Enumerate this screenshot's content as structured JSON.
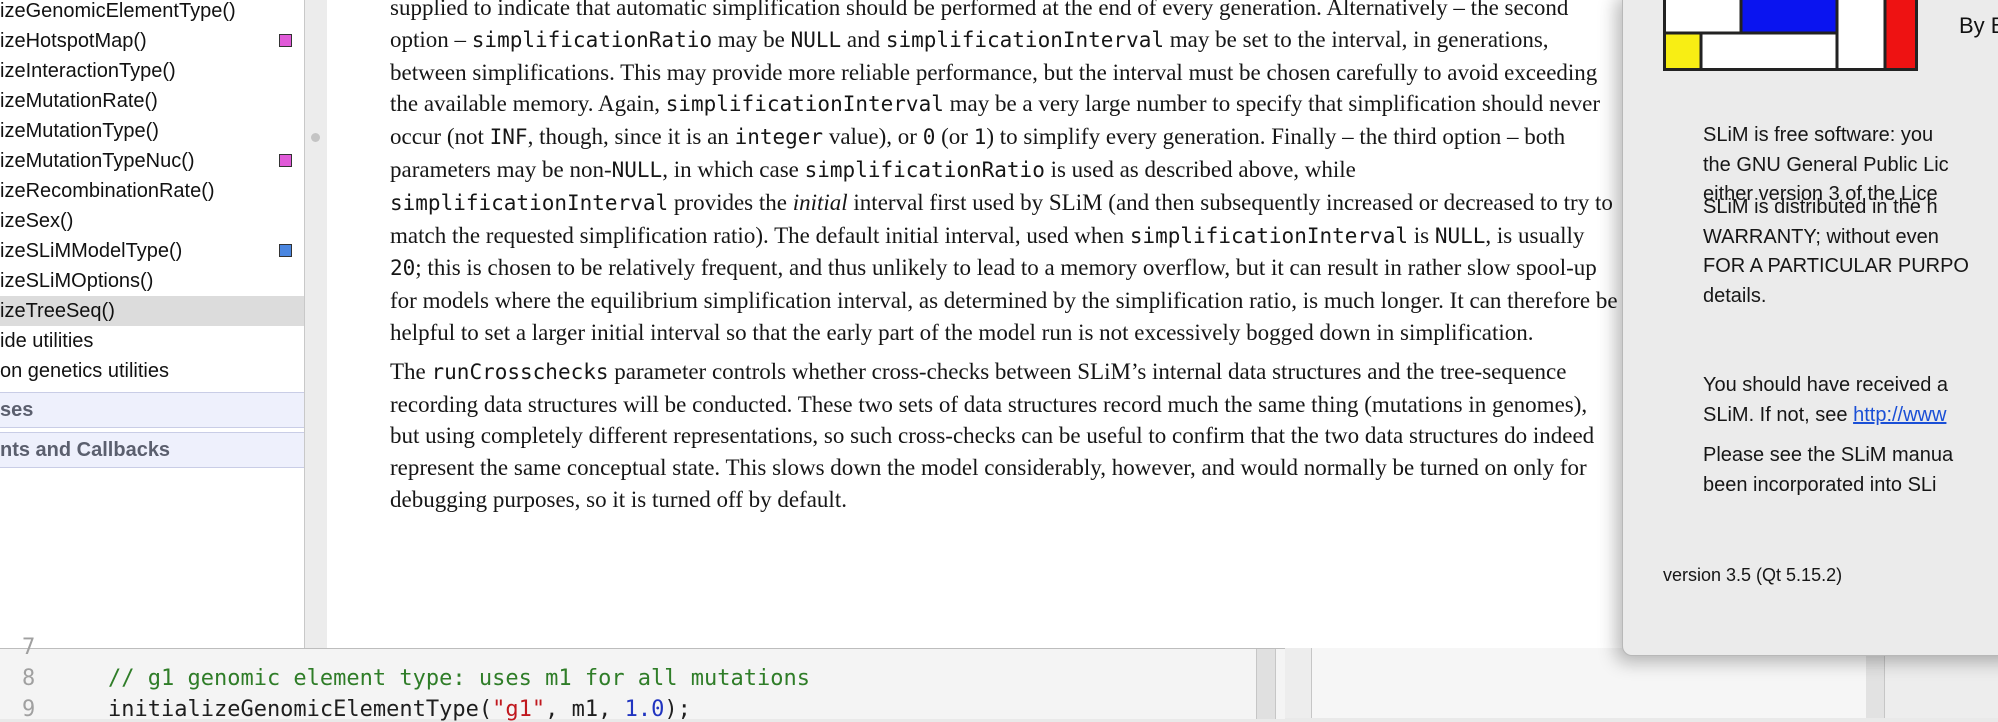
{
  "sidebar": {
    "items": [
      {
        "label": "izeGenomicElementType()",
        "swatch": ""
      },
      {
        "label": "izeHotspotMap()",
        "swatch": "#e05ad8"
      },
      {
        "label": "izeInteractionType()",
        "swatch": ""
      },
      {
        "label": "izeMutationRate()",
        "swatch": ""
      },
      {
        "label": "izeMutationType()",
        "swatch": ""
      },
      {
        "label": "izeMutationTypeNuc()",
        "swatch": "#e05ad8"
      },
      {
        "label": "izeRecombinationRate()",
        "swatch": ""
      },
      {
        "label": "izeSex()",
        "swatch": ""
      },
      {
        "label": "izeSLiMModelType()",
        "swatch": "#4a86e0"
      },
      {
        "label": "izeSLiMOptions()",
        "swatch": ""
      },
      {
        "label": "izeTreeSeq()",
        "swatch": "",
        "selected": true
      },
      {
        "label": "ide utilities",
        "swatch": ""
      },
      {
        "label": "on genetics utilities",
        "swatch": ""
      }
    ],
    "sections": [
      {
        "label": "ses"
      },
      {
        "label": "nts and Callbacks"
      }
    ]
  },
  "doc": {
    "p1": [
      {
        "t": "supplied to indicate that automatic simplification should be performed at the end of every generation.  Alternatively – the second option – "
      },
      {
        "c": "simplificationRatio"
      },
      {
        "t": " may be "
      },
      {
        "c": "NULL"
      },
      {
        "t": " and "
      },
      {
        "c": "simplificationInterval"
      },
      {
        "t": " may be set to the interval, in generations, between simplifications.  This may provide more reliable performance, but the interval must be chosen carefully to avoid exceeding the available memory.  Again, "
      },
      {
        "c": "simplificationInterval"
      },
      {
        "t": " may be a very large number to specify that simplification should never occur (not "
      },
      {
        "c": "INF"
      },
      {
        "t": ", though, since it is an "
      },
      {
        "c": "integer"
      },
      {
        "t": " value), or "
      },
      {
        "c": "0"
      },
      {
        "t": " (or "
      },
      {
        "c": "1"
      },
      {
        "t": ") to simplify every generation.  Finally – the third option – both parameters may be non-"
      },
      {
        "c": "NULL"
      },
      {
        "t": ", in which case "
      },
      {
        "c": "simplificationRatio"
      },
      {
        "t": " is used as described above, while "
      },
      {
        "c": "simplificationInterval"
      },
      {
        "t": " provides the "
      },
      {
        "i": "initial"
      },
      {
        "t": " interval first used by SLiM (and then subsequently increased or decreased to try to match the requested simplification ratio).  The default initial interval, used when "
      },
      {
        "c": "simplificationInterval"
      },
      {
        "t": " is "
      },
      {
        "c": "NULL"
      },
      {
        "t": ", is usually "
      },
      {
        "c": "20"
      },
      {
        "t": "; this is chosen to be relatively frequent, and thus unlikely to lead to a memory overflow, but it can result in rather slow spool-up for models where the equilibrium simplification interval, as determined by the simplification ratio, is much longer.  It can therefore be helpful to set a larger initial interval so that the early part of the model run is not excessively bogged down in simplification."
      }
    ],
    "p2": [
      {
        "t": "The "
      },
      {
        "c": "runCrosschecks"
      },
      {
        "t": " parameter controls whether cross-checks between SLiM’s internal data structures and the tree-sequence recording data structures will be conducted.  These two sets of data structures record much the same thing (mutations in genomes), but using completely different representations, so such cross-checks can be useful to confirm that the two data structures do indeed represent the same conceptual state.  This slows down the model considerably, however, and would normally be turned on only for debugging purposes, so it is turned off by default."
      }
    ]
  },
  "editor": {
    "lines": [
      {
        "num": "7",
        "parts": []
      },
      {
        "num": "8",
        "parts": [
          {
            "k": "cmt",
            "t": "// g1 genomic element type: uses m1 for all mutations"
          }
        ]
      },
      {
        "num": "9",
        "parts": [
          {
            "k": "",
            "t": "initializeGenomicElementType("
          },
          {
            "k": "str",
            "t": "\"g1\""
          },
          {
            "k": "",
            "t": ", m1, "
          },
          {
            "k": "num",
            "t": "1.0"
          },
          {
            "k": "",
            "t": ");"
          }
        ]
      }
    ]
  },
  "about": {
    "by": "By B",
    "paragraphs": [
      {
        "lines": [
          "SLiM is free software: you",
          "the GNU General Public Lic",
          "either version 3 of the Lice"
        ]
      },
      {
        "lines": [
          "SLiM is distributed in the h",
          "WARRANTY; without even",
          "FOR A PARTICULAR PURPO",
          "details."
        ]
      },
      {
        "lines": [
          "You should have received a"
        ],
        "link_prefix": "SLiM. If not, see ",
        "link": "http://www"
      },
      {
        "lines": [
          "Please see the SLiM manua",
          "been incorporated into SLi"
        ]
      }
    ],
    "version": "version 3.5 (Qt 5.15.2)",
    "logo_colors": {
      "blue": "#0a14f0",
      "yellow": "#f8ee14",
      "red": "#ee1212",
      "white": "#ffffff",
      "frame": "#222222"
    }
  }
}
